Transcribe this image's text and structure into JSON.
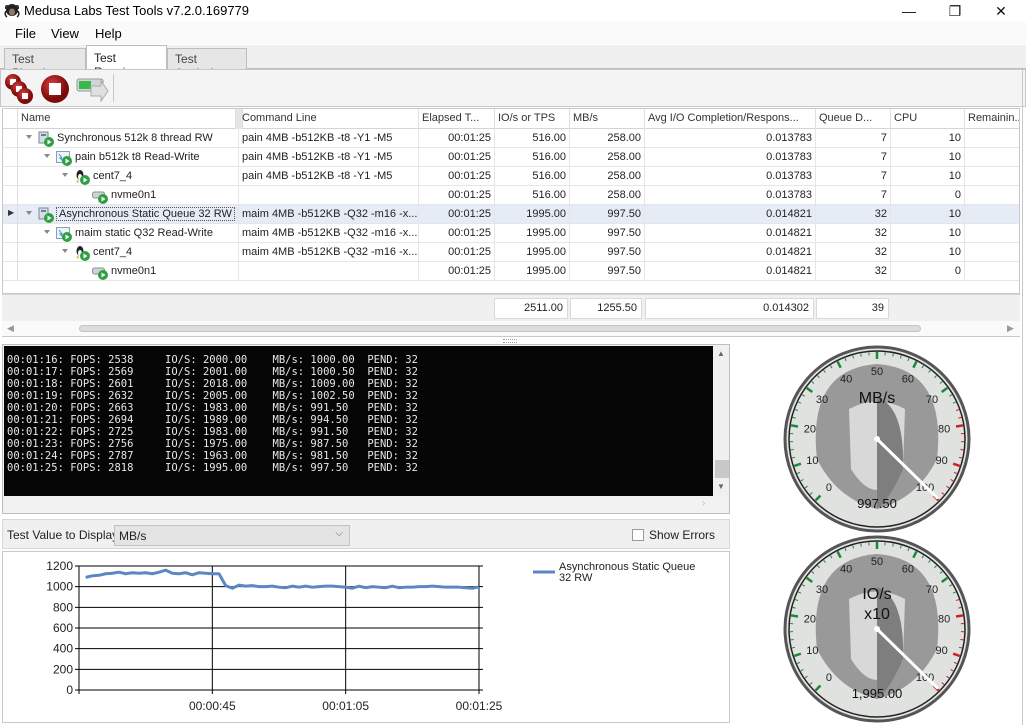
{
  "window": {
    "title": "Medusa Labs Test Tools v7.2.0.169779",
    "controls": {
      "minimize": "—",
      "restore": "❐",
      "close": "✕"
    }
  },
  "menu": [
    "File",
    "View",
    "Help"
  ],
  "tabs": [
    {
      "label": "Test Planning",
      "active": false
    },
    {
      "label": "Test Running",
      "active": true
    },
    {
      "label": "Test Analysis",
      "active": false
    }
  ],
  "toolbar": {
    "buttons": [
      {
        "name": "stop-all-icon",
        "tooltip": ""
      },
      {
        "name": "stop-icon",
        "tooltip": ""
      },
      {
        "name": "export-icon",
        "tooltip": ""
      }
    ]
  },
  "grid": {
    "columns": [
      "Name",
      "Command Line",
      "Elapsed T...",
      "IO/s or TPS",
      "MB/s",
      "Avg I/O Completion/Respons...",
      "Queue D...",
      "CPU",
      "Remainin..."
    ],
    "rows": [
      {
        "level": 0,
        "icon": "test-group-icon",
        "name": "Synchronous 512k 8 thread RW",
        "cmd": "pain 4MB -b512KB -t8 -Y1 -M5",
        "elapsed": "00:01:25",
        "iops": "516.00",
        "mbs": "258.00",
        "avg": "0.013783",
        "qd": "7",
        "cpu": "10",
        "remaining": ""
      },
      {
        "level": 1,
        "icon": "test-icon",
        "name": "pain b512k t8 Read-Write",
        "cmd": "pain 4MB -b512KB -t8 -Y1 -M5",
        "elapsed": "00:01:25",
        "iops": "516.00",
        "mbs": "258.00",
        "avg": "0.013783",
        "qd": "7",
        "cpu": "10",
        "remaining": ""
      },
      {
        "level": 2,
        "icon": "linux-host-icon",
        "name": "cent7_4",
        "cmd": "pain 4MB -b512KB -t8 -Y1 -M5",
        "elapsed": "00:01:25",
        "iops": "516.00",
        "mbs": "258.00",
        "avg": "0.013783",
        "qd": "7",
        "cpu": "10",
        "remaining": ""
      },
      {
        "level": 3,
        "icon": "disk-icon",
        "name": "nvme0n1",
        "cmd": "",
        "elapsed": "00:01:25",
        "iops": "516.00",
        "mbs": "258.00",
        "avg": "0.013783",
        "qd": "7",
        "cpu": "0",
        "remaining": ""
      },
      {
        "level": 0,
        "icon": "test-group-icon",
        "name": "Asynchronous Static Queue 32 RW",
        "cmd": "maim 4MB -b512KB -Q32 -m16 -x...",
        "elapsed": "00:01:25",
        "iops": "1995.00",
        "mbs": "997.50",
        "avg": "0.014821",
        "qd": "32",
        "cpu": "10",
        "remaining": "",
        "selected": true
      },
      {
        "level": 1,
        "icon": "test-icon",
        "name": "maim static Q32 Read-Write",
        "cmd": "maim 4MB -b512KB -Q32 -m16 -x...",
        "elapsed": "00:01:25",
        "iops": "1995.00",
        "mbs": "997.50",
        "avg": "0.014821",
        "qd": "32",
        "cpu": "10",
        "remaining": ""
      },
      {
        "level": 2,
        "icon": "linux-host-icon",
        "name": "cent7_4",
        "cmd": "maim 4MB -b512KB -Q32 -m16 -x...",
        "elapsed": "00:01:25",
        "iops": "1995.00",
        "mbs": "997.50",
        "avg": "0.014821",
        "qd": "32",
        "cpu": "10",
        "remaining": ""
      },
      {
        "level": 3,
        "icon": "disk-icon",
        "name": "nvme0n1",
        "cmd": "",
        "elapsed": "00:01:25",
        "iops": "1995.00",
        "mbs": "997.50",
        "avg": "0.014821",
        "qd": "32",
        "cpu": "0",
        "remaining": ""
      }
    ],
    "totals": {
      "iops": "2511.00",
      "mbs": "1255.50",
      "avg": "0.014302",
      "qd": "39"
    }
  },
  "console": {
    "lines": [
      "00:01:16: FOPS: 2538     IO/S: 2000.00    MB/s: 1000.00  PEND: 32",
      "00:01:17: FOPS: 2569     IO/S: 2001.00    MB/s: 1000.50  PEND: 32",
      "00:01:18: FOPS: 2601     IO/S: 2018.00    MB/s: 1009.00  PEND: 32",
      "00:01:19: FOPS: 2632     IO/S: 2005.00    MB/s: 1002.50  PEND: 32",
      "00:01:20: FOPS: 2663     IO/S: 1983.00    MB/s: 991.50   PEND: 32",
      "00:01:21: FOPS: 2694     IO/S: 1989.00    MB/s: 994.50   PEND: 32",
      "00:01:22: FOPS: 2725     IO/S: 1983.00    MB/s: 991.50   PEND: 32",
      "00:01:23: FOPS: 2756     IO/S: 1975.00    MB/s: 987.50   PEND: 32",
      "00:01:24: FOPS: 2787     IO/S: 1963.00    MB/s: 981.50   PEND: 32",
      "00:01:25: FOPS: 2818     IO/S: 1995.00    MB/s: 997.50   PEND: 32"
    ]
  },
  "display_options": {
    "label": "Test Value to Display",
    "selected": "MB/s",
    "show_errors_label": "Show Errors",
    "show_errors_checked": false
  },
  "chart_data": {
    "type": "line",
    "title": "",
    "xlabel": "",
    "ylabel": "",
    "ylim": [
      0,
      1200
    ],
    "yticks": [
      0,
      200,
      400,
      600,
      800,
      1000,
      1200
    ],
    "xlim_seconds": [
      25,
      85
    ],
    "xticks": [
      {
        "label": "00:00:45",
        "seconds": 45
      },
      {
        "label": "00:01:05",
        "seconds": 65
      },
      {
        "label": "00:01:25",
        "seconds": 85
      }
    ],
    "grid": true,
    "legend_position": "right",
    "series": [
      {
        "name": "Asynchronous Static Queue 32 RW",
        "color": "#5b88c2",
        "x": [
          26,
          27,
          28,
          29,
          30,
          31,
          32,
          33,
          34,
          35,
          36,
          37,
          38,
          39,
          40,
          41,
          42,
          43,
          44,
          45,
          46,
          47,
          48,
          49,
          50,
          51,
          52,
          53,
          54,
          55,
          56,
          57,
          58,
          59,
          60,
          61,
          62,
          63,
          64,
          65,
          66,
          67,
          68,
          69,
          70,
          71,
          72,
          73,
          74,
          75,
          76,
          77,
          78,
          79,
          80,
          81,
          82,
          83,
          84,
          85
        ],
        "values": [
          1090,
          1105,
          1110,
          1125,
          1130,
          1140,
          1125,
          1135,
          1130,
          1135,
          1125,
          1140,
          1160,
          1130,
          1125,
          1135,
          1115,
          1135,
          1130,
          1125,
          1125,
          1010,
          985,
          1015,
          1005,
          1010,
          1000,
          1000,
          1005,
          995,
          990,
          1005,
          995,
          1005,
          995,
          1000,
          1005,
          1005,
          1000,
          995,
          985,
          1005,
          990,
          1000,
          995,
          990,
          1005,
          990,
          995,
          995,
          1000,
          1000,
          1005,
          1000,
          995,
          995,
          995,
          990,
          985,
          997.5
        ]
      }
    ]
  },
  "gauges": [
    {
      "title": "MB/s",
      "subtitle": "",
      "value_text": "997.50",
      "value": 99.75,
      "max": 100,
      "ticks": [
        "0",
        "10",
        "20",
        "30",
        "40",
        "50",
        "60",
        "70",
        "80",
        "90",
        "100"
      ]
    },
    {
      "title": "IO/s",
      "subtitle": "x10",
      "value_text": "1,995.00",
      "value": 99.75,
      "max": 100,
      "ticks": [
        "0",
        "10",
        "20",
        "30",
        "40",
        "50",
        "60",
        "70",
        "80",
        "90",
        "100"
      ]
    }
  ]
}
